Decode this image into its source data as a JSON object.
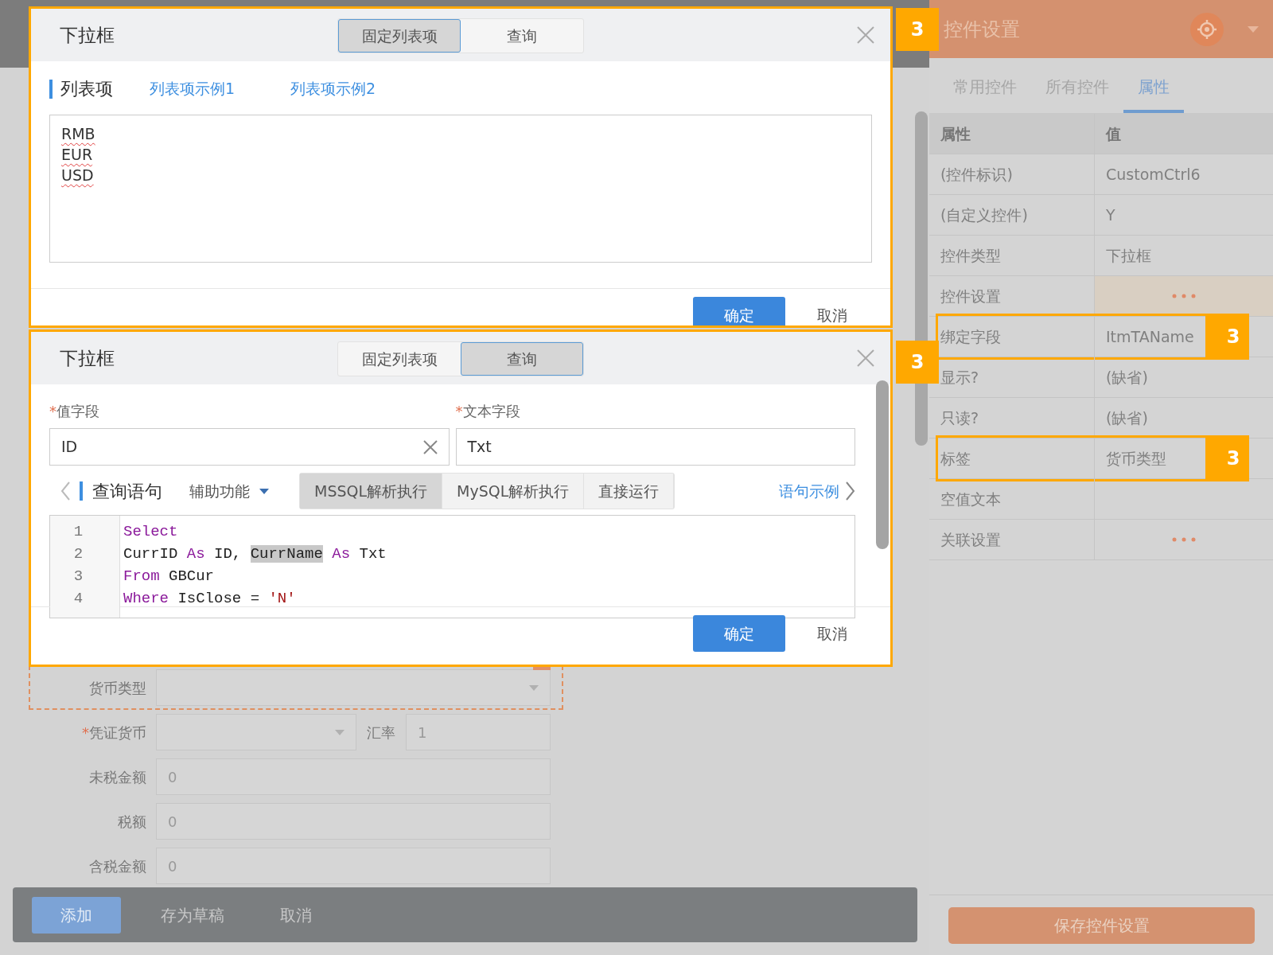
{
  "form": {
    "fields": [
      {
        "label": "货币类型",
        "kind": "select",
        "selected": true
      },
      {
        "label": "凭证货币",
        "kind": "select_rate",
        "required_mark": "*",
        "selected": false,
        "rate_label": "汇率",
        "rate_value": "1"
      },
      {
        "label": "未税金额",
        "kind": "text",
        "selected": false,
        "value": "0"
      },
      {
        "label": "税额",
        "kind": "text",
        "selected": false,
        "value": "0"
      },
      {
        "label": "含税金额",
        "kind": "text",
        "selected": false,
        "value": "0"
      }
    ],
    "actions": [
      {
        "label": "添加",
        "primary": true
      },
      {
        "label": "存为草稿",
        "primary": false
      },
      {
        "label": "取消",
        "primary": false
      }
    ]
  },
  "panel": {
    "title": "控件设置",
    "tabs": [
      {
        "label": "常用控件",
        "selected": false
      },
      {
        "label": "所有控件",
        "selected": false
      },
      {
        "label": "属性",
        "selected": true
      }
    ],
    "columns": [
      "属性",
      "值"
    ],
    "rows": [
      {
        "name": "(控件标识)",
        "kind": "text",
        "value": "CustomCtrl6",
        "selected": false
      },
      {
        "name": "(自定义控件)",
        "kind": "text",
        "value": "Y",
        "selected": false
      },
      {
        "name": "控件类型",
        "kind": "text",
        "value": "下拉框",
        "selected": false
      },
      {
        "name": "控件设置",
        "kind": "ellipsis",
        "value": "",
        "selected": true
      },
      {
        "name": "绑定字段",
        "kind": "text",
        "value": "ItmTAName",
        "selected": false,
        "callout": "3"
      },
      {
        "name": "显示?",
        "kind": "text",
        "value": "(缺省)",
        "selected": false
      },
      {
        "name": "只读?",
        "kind": "text",
        "value": "(缺省)",
        "selected": false
      },
      {
        "name": "标签",
        "kind": "text",
        "value": "货币类型",
        "selected": false,
        "callout": "3"
      },
      {
        "name": "空值文本",
        "kind": "text",
        "selected": false
      },
      {
        "name": "关联设置",
        "kind": "ellipsis",
        "value": "",
        "selected": false
      }
    ],
    "save_button": "保存控件设置"
  },
  "dialogs": [
    {
      "kind": "list",
      "title": "下拉框",
      "callout": "3",
      "tabs": [
        {
          "label": "固定列表项",
          "selected": true
        },
        {
          "label": "查询",
          "selected": false
        }
      ],
      "section_title": "列表项",
      "links": [
        "列表项示例1",
        "列表项示例2"
      ],
      "items": [
        "RMB",
        "EUR",
        "USD"
      ],
      "ok": "确定",
      "cancel": "取消"
    },
    {
      "kind": "query",
      "title": "下拉框",
      "callout": "3",
      "tabs": [
        {
          "label": "固定列表项",
          "selected": false
        },
        {
          "label": "查询",
          "selected": true
        }
      ],
      "fields": [
        {
          "label": "值字段",
          "required_mark": "*",
          "value": "ID",
          "clearable": true
        },
        {
          "label": "文本字段",
          "required_mark": "*",
          "value": "Txt",
          "clearable": false
        }
      ],
      "section_title": "查询语句",
      "helper": "辅助功能",
      "modes": [
        {
          "label": "MSSQL解析执行",
          "selected": true
        },
        {
          "label": "MySQL解析执行",
          "selected": false
        },
        {
          "label": "直接运行",
          "selected": false
        }
      ],
      "examples_link": "语句示例",
      "code": [
        {
          "number": "1",
          "tokens": [
            {
              "kind": "keyword",
              "text": "Select"
            }
          ]
        },
        {
          "number": "2",
          "tokens": [
            {
              "kind": "plain",
              "text": "CurrID "
            },
            {
              "kind": "keyword",
              "text": "As"
            },
            {
              "kind": "plain",
              "text": " ID, "
            },
            {
              "kind": "highlight",
              "text": "CurrName"
            },
            {
              "kind": "keyword",
              "text": " As"
            },
            {
              "kind": "plain",
              "text": " Txt"
            }
          ]
        },
        {
          "number": "3",
          "tokens": [
            {
              "kind": "keyword",
              "text": "From"
            },
            {
              "kind": "plain",
              "text": " GBCur"
            }
          ]
        },
        {
          "number": "4",
          "tokens": [
            {
              "kind": "keyword",
              "text": "Where"
            },
            {
              "kind": "plain",
              "text": " IsClose = "
            },
            {
              "kind": "string",
              "text": "'N'"
            }
          ]
        }
      ],
      "ok": "确定",
      "cancel": "取消"
    }
  ]
}
